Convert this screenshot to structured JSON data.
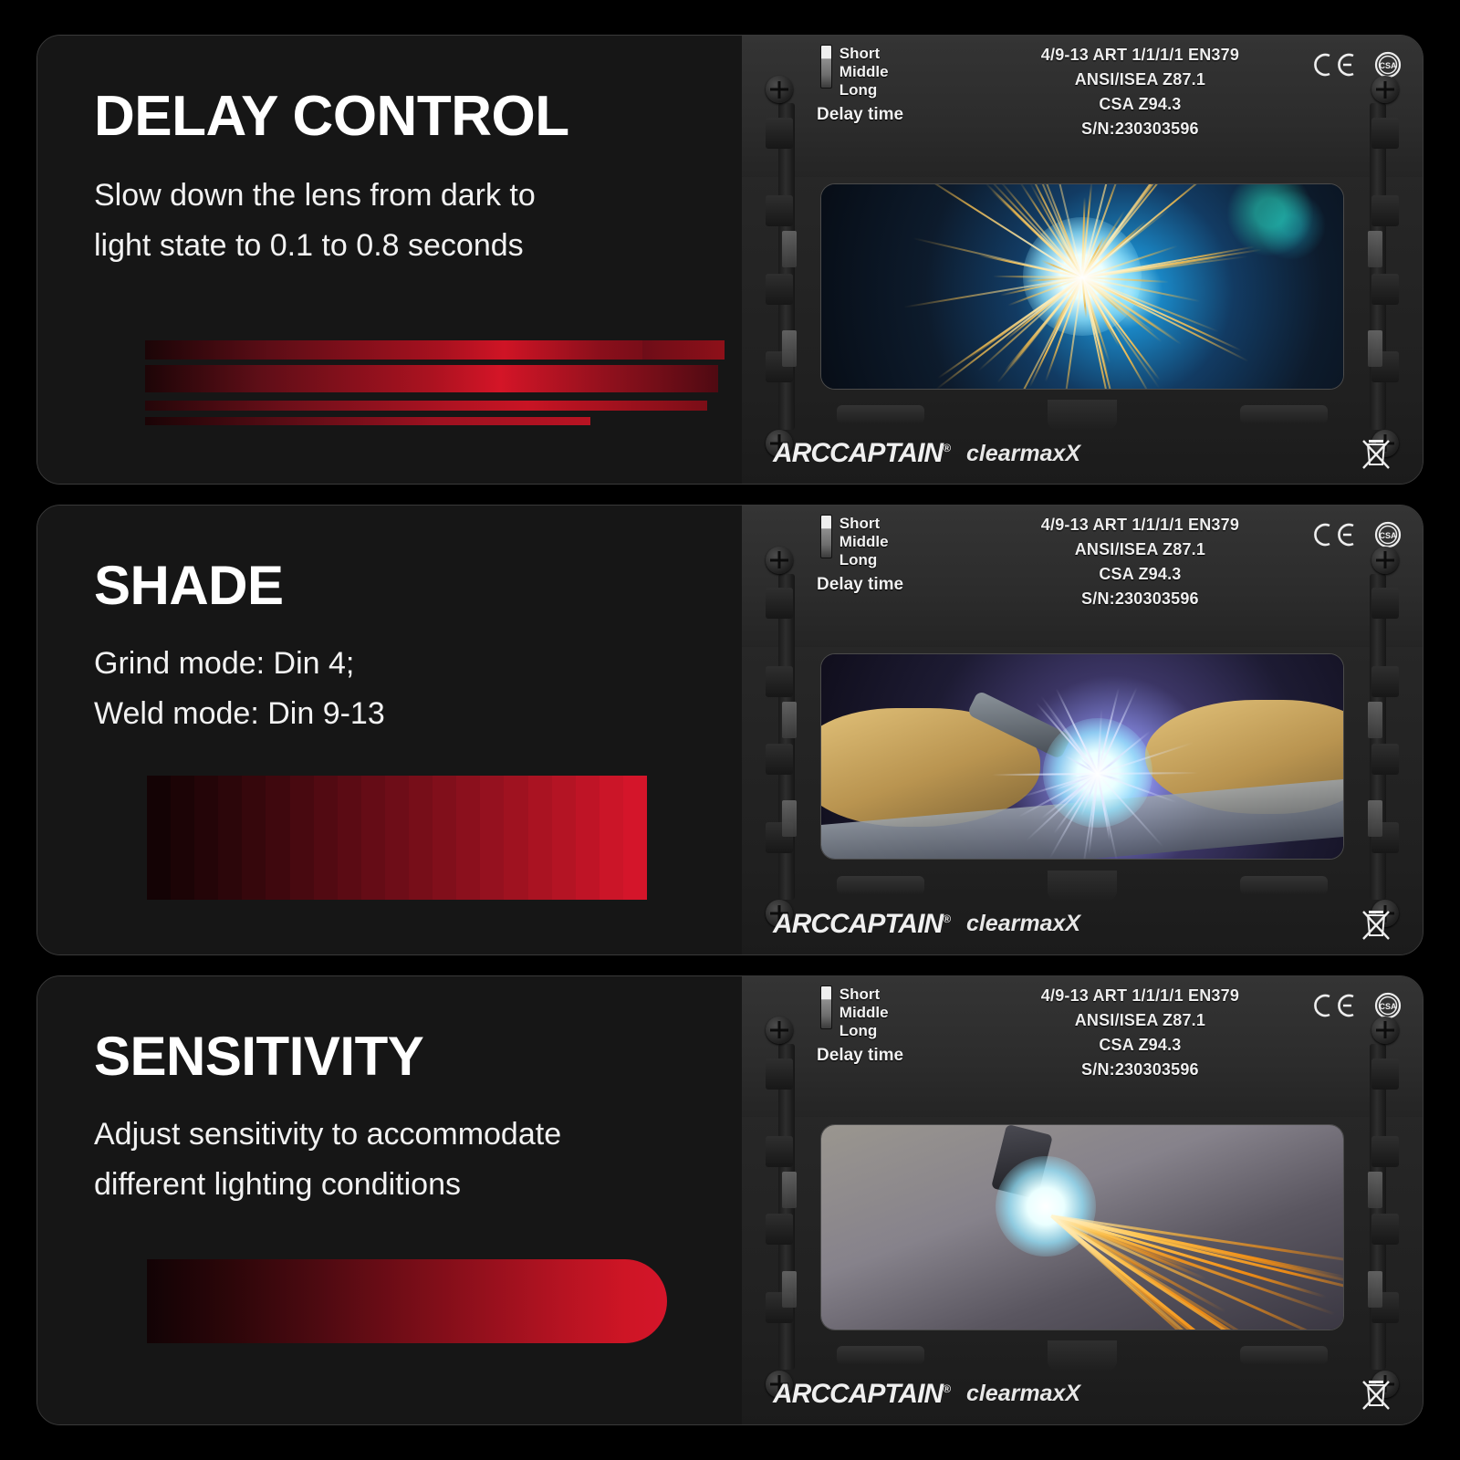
{
  "theme": {
    "page_bg": "#000000",
    "panel_bg": "#161616",
    "accent_red": "#d4152a",
    "text_primary": "#ffffff"
  },
  "panels": [
    {
      "id": "delay-control",
      "headline": "DELAY CONTROL",
      "body_lines": [
        "Slow down the lens from dark to",
        "light state to 0.1 to 0.8 seconds"
      ],
      "graphic": "red-speed-stripes",
      "scene_caption": "welding arc spark burst"
    },
    {
      "id": "shade",
      "headline": "SHADE",
      "body_lines": [
        "Grind mode: Din 4;",
        "Weld mode: Din 9-13"
      ],
      "graphic": "shade-step-gradient",
      "scene_caption": "tig welding with gloves"
    },
    {
      "id": "sensitivity",
      "headline": "SENSITIVITY",
      "body_lines": [
        "Adjust sensitivity to accommodate",
        "different lighting conditions"
      ],
      "graphic": "sensitivity-gradient-bar",
      "scene_caption": "plasma cutting sparks"
    }
  ],
  "product_label": {
    "delay_switch": {
      "options": [
        "Short",
        "Middle",
        "Long"
      ],
      "selected": "Short",
      "caption": "Delay time"
    },
    "certifications": [
      "4/9-13 ART 1/1/1/1 EN379",
      "ANSI/ISEA Z87.1",
      "CSA Z94.3",
      "S/N:230303596"
    ],
    "marks": [
      "ce-mark",
      "csa-mark",
      "weee-bin-icon"
    ]
  },
  "branding": {
    "name": "ARCCAPTAIN",
    "registered": "®",
    "sub_brand": "clearmaxX"
  },
  "shade_steps": [
    "#140305",
    "#1c0406",
    "#240508",
    "#2c060a",
    "#36070c",
    "#3f080e",
    "#480910",
    "#520a12",
    "#5b0b14",
    "#650c16",
    "#6e0d18",
    "#770e19",
    "#810f1b",
    "#8b101d",
    "#95111f",
    "#9f1220",
    "#aa1322",
    "#b41424",
    "#bf1426",
    "#cb1528",
    "#d4152a"
  ]
}
